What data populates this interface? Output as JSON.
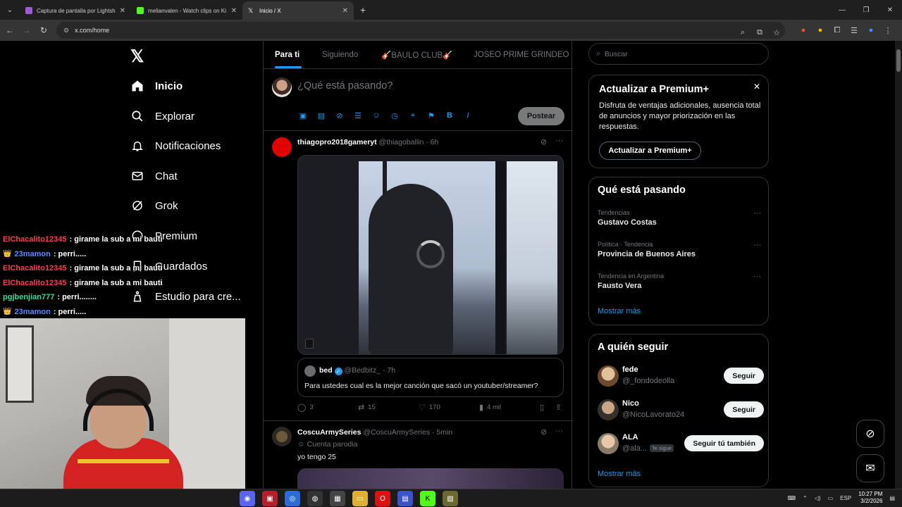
{
  "browser": {
    "tabs": [
      {
        "label": "Captura de pantalla por Lightsh",
        "color": "#a05bd6",
        "active": false
      },
      {
        "label": "melianvalen - Watch clips on Ki",
        "color": "#53fc18",
        "active": false
      },
      {
        "label": "Inicio / X",
        "color": "#ffffff",
        "active": true
      }
    ],
    "url": "x.com/home"
  },
  "nav": {
    "items": [
      {
        "label": "Inicio",
        "icon": "home-icon"
      },
      {
        "label": "Explorar",
        "icon": "search-icon"
      },
      {
        "label": "Notificaciones",
        "icon": "bell-icon"
      },
      {
        "label": "Chat",
        "icon": "mail-icon"
      },
      {
        "label": "Grok",
        "icon": "grok-icon"
      },
      {
        "label": "Premium",
        "icon": "x-premium-icon"
      },
      {
        "label": "Guardados",
        "icon": "bookmark-icon"
      },
      {
        "label": "Estudio para cre...",
        "icon": "creator-studio-icon"
      }
    ]
  },
  "chat_overlay": [
    {
      "user": "ElChacalito12345",
      "color": "#ff3c4e",
      "badge": false,
      "msg": ": girame la sub a mi bauti"
    },
    {
      "user": "23mamon",
      "color": "#5a8bff",
      "badge": true,
      "msg": ": perri....."
    },
    {
      "user": "ElChacalito12345",
      "color": "#ff3c4e",
      "badge": false,
      "msg": ": girame la sub a mi bauti"
    },
    {
      "user": "ElChacalito12345",
      "color": "#ff3c4e",
      "badge": false,
      "msg": ": girame la sub a mi bauti"
    },
    {
      "user": "pgjbenjian777",
      "color": "#38d99b",
      "badge": false,
      "msg": ": perri........"
    },
    {
      "user": "23mamon",
      "color": "#5a8bff",
      "badge": true,
      "msg": ": perri....."
    }
  ],
  "feed_tabs": [
    "Para ti",
    "Siguiendo",
    "🎸BAULO CLUB🎸",
    "JOSEO PRIME GRINDEO"
  ],
  "compose": {
    "placeholder": "¿Qué está pasando?",
    "post_label": "Postear"
  },
  "post1": {
    "name": "thiagopro2018gameryt",
    "handle": "@thiagoballin · 6h",
    "quote": {
      "name": "bed",
      "handle": "@Bedbitz_ · 7h",
      "text": "Para ustedes cual es la mejor canción que sacó un youtuber/streamer?"
    },
    "stats": {
      "replies": "3",
      "reposts": "15",
      "likes": "170",
      "views": "4 mil"
    }
  },
  "post2": {
    "name": "CoscuArmySeries",
    "handle": "@CoscuArmySeries · 5min",
    "parody": "Cuenta parodia",
    "text": "yo tengo 25"
  },
  "search": {
    "placeholder": "Buscar"
  },
  "premium": {
    "title": "Actualizar a Premium+",
    "text": "Disfruta de ventajas adicionales, ausencia total de anuncios y mayor priorización en las respuestas.",
    "button": "Actualizar a Premium+"
  },
  "trending": {
    "title": "Qué está pasando",
    "items": [
      {
        "meta": "Tendencias",
        "name": "Gustavo Costas"
      },
      {
        "meta": "Política · Tendencia",
        "name": "Provincia de Buenos Aires"
      },
      {
        "meta": "Tendencia en Argentina",
        "name": "Fausto Vera"
      }
    ],
    "show_more": "Mostrar más"
  },
  "who_to_follow": {
    "title": "A quién seguir",
    "items": [
      {
        "name": "fede",
        "handle": "@_fondodeolla",
        "tag": "",
        "button": "Seguir"
      },
      {
        "name": "Nico",
        "handle": "@NicoLavorato24",
        "tag": "",
        "button": "Seguir"
      },
      {
        "name": "ALA",
        "handle": "@ala...",
        "tag": "Te sigue",
        "button": "Seguir tú también"
      }
    ],
    "show_more": "Mostrar más"
  },
  "taskbar": {
    "lang": "ESP",
    "time": "10:27 PM",
    "date": "3/2/2026"
  }
}
